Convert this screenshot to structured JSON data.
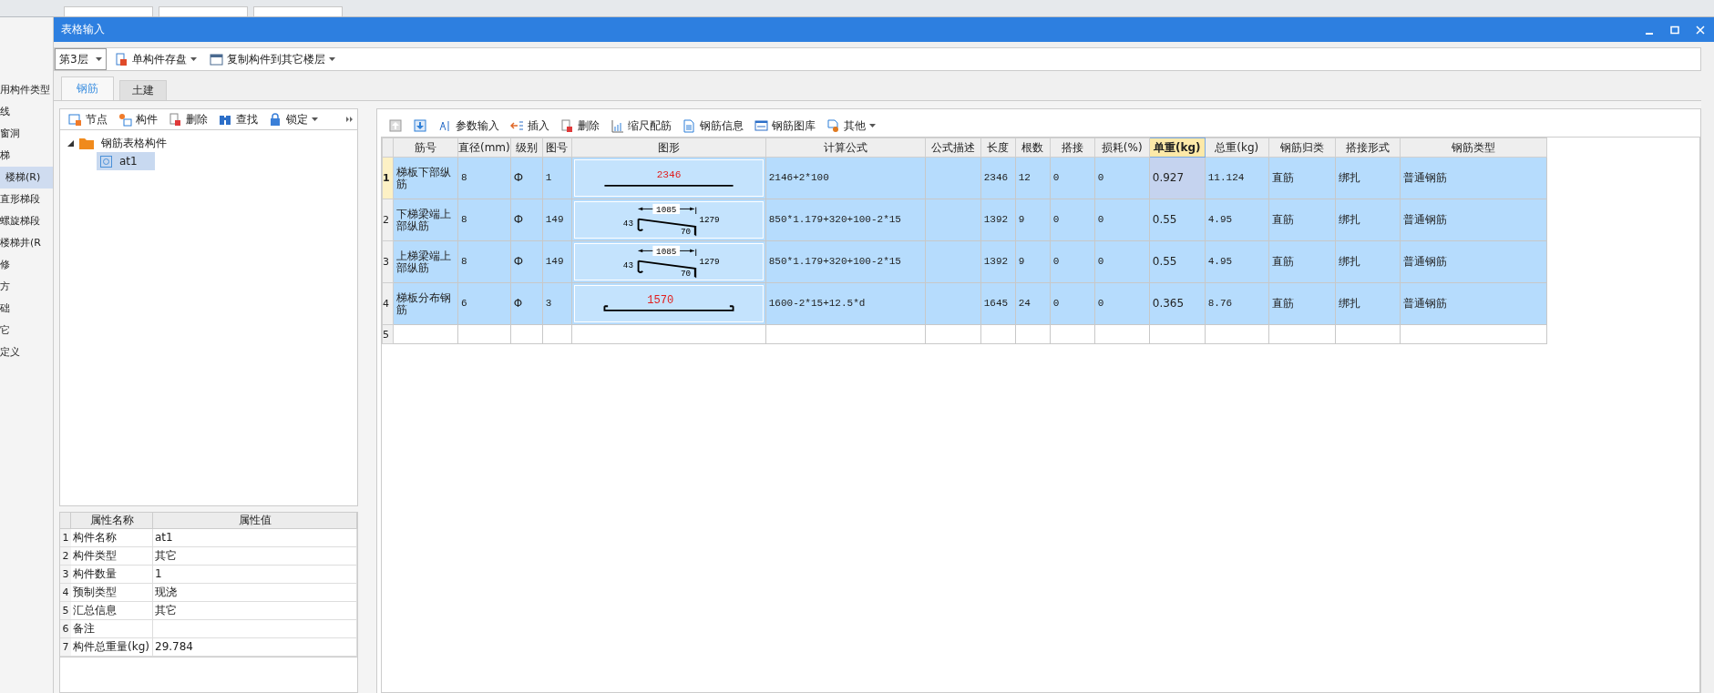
{
  "background_app": {
    "sidebar_items": [
      {
        "label": "用构件类型",
        "selected": false
      },
      {
        "label": "线",
        "selected": false
      },
      {
        "label": "窗洞",
        "selected": false
      },
      {
        "label": "梯",
        "selected": false
      },
      {
        "label": "楼梯(R)",
        "selected": true
      },
      {
        "label": "直形梯段",
        "selected": false
      },
      {
        "label": "螺旋梯段",
        "selected": false
      },
      {
        "label": "楼梯井(R",
        "selected": false
      },
      {
        "label": "修",
        "selected": false
      },
      {
        "label": "方",
        "selected": false
      },
      {
        "label": "础",
        "selected": false
      },
      {
        "label": "它",
        "selected": false
      },
      {
        "label": "定义",
        "selected": false
      }
    ]
  },
  "window": {
    "title": "表格输入"
  },
  "toolbar": {
    "floor_select": {
      "value": "第3层"
    },
    "buttons": [
      {
        "kind": "save",
        "label": "单构件存盘",
        "dropdown": true
      },
      {
        "kind": "copy",
        "label": "复制构件到其它楼层",
        "dropdown": true
      }
    ]
  },
  "tabs": [
    {
      "label": "钢筋",
      "selected": true
    },
    {
      "label": "土建",
      "selected": false
    }
  ],
  "component_panel": {
    "toolbar": [
      {
        "kind": "node",
        "label": "节点",
        "dropdown": false
      },
      {
        "kind": "component",
        "label": "构件",
        "dropdown": false
      },
      {
        "kind": "delete",
        "label": "删除",
        "dropdown": false
      },
      {
        "kind": "find",
        "label": "查找",
        "dropdown": false
      },
      {
        "kind": "lock",
        "label": "锁定",
        "dropdown": true
      }
    ],
    "tree": [
      {
        "label": "钢筋表格构件",
        "expanded": true,
        "selected": false,
        "children": [
          {
            "label": "at1",
            "selected": true
          }
        ]
      }
    ],
    "properties": {
      "columns": [
        "属性名称",
        "属性值"
      ],
      "rows": [
        {
          "no": "1",
          "name": "构件名称",
          "value": "at1"
        },
        {
          "no": "2",
          "name": "构件类型",
          "value": "其它"
        },
        {
          "no": "3",
          "name": "构件数量",
          "value": "1"
        },
        {
          "no": "4",
          "name": "预制类型",
          "value": "现浇"
        },
        {
          "no": "5",
          "name": "汇总信息",
          "value": "其它"
        },
        {
          "no": "6",
          "name": "备注"
        },
        {
          "no": "7",
          "name": "构件总重量(kg)",
          "value": "29.784"
        }
      ]
    }
  },
  "rebar_panel": {
    "toolbar": [
      {
        "kind": "up",
        "dropdown": false
      },
      {
        "kind": "down",
        "dropdown": false
      },
      {
        "kind": "param",
        "label": "参数输入",
        "dropdown": false
      },
      {
        "kind": "insert",
        "label": "插入",
        "dropdown": false
      },
      {
        "kind": "delete",
        "label": "删除",
        "dropdown": false
      },
      {
        "kind": "scale",
        "label": "缩尺配筋",
        "dropdown": false
      },
      {
        "kind": "info",
        "label": "钢筋信息",
        "dropdown": false
      },
      {
        "kind": "library",
        "label": "钢筋图库",
        "dropdown": false
      },
      {
        "kind": "other",
        "label": "其他",
        "dropdown": true
      }
    ],
    "table": {
      "columns": [
        {
          "label": "筋号",
          "active": false
        },
        {
          "label": "直径(mm)",
          "active": false
        },
        {
          "label": "级别",
          "active": false
        },
        {
          "label": "图号",
          "active": false
        },
        {
          "label": "图形",
          "active": false
        },
        {
          "label": "计算公式",
          "active": false
        },
        {
          "label": "公式描述",
          "active": false
        },
        {
          "label": "长度",
          "active": false
        },
        {
          "label": "根数",
          "active": false
        },
        {
          "label": "搭接",
          "active": false
        },
        {
          "label": "损耗(%)",
          "active": false
        },
        {
          "label": "单重(kg)",
          "active": true
        },
        {
          "label": "总重(kg)",
          "active": false
        },
        {
          "label": "钢筋归类",
          "active": false
        },
        {
          "label": "搭接形式",
          "active": false
        },
        {
          "label": "钢筋类型",
          "active": false
        }
      ],
      "rows": [
        {
          "no": "1",
          "selected": true,
          "current": true,
          "cells": [
            "梯板下部纵筋",
            "8",
            "Ф",
            "1",
            {
              "kind": "straight",
              "labels": [
                "2346"
              ]
            },
            "2146+2*100",
            null,
            "2346",
            "12",
            "0",
            "0",
            "0.927",
            "11.124",
            "直筋",
            "绑扎",
            "普通钢筋"
          ]
        },
        {
          "no": "2",
          "selected": true,
          "current": false,
          "cells": [
            "下梯梁端上部纵筋",
            "8",
            "Ф",
            "149",
            {
              "kind": "bent",
              "labels": [
                "1085",
                "43",
                "1279",
                "70"
              ]
            },
            "850*1.179+320+100-2*15",
            null,
            "1392",
            "9",
            "0",
            "0",
            "0.55",
            "4.95",
            "直筋",
            "绑扎",
            "普通钢筋"
          ]
        },
        {
          "no": "3",
          "selected": true,
          "current": false,
          "cells": [
            "上梯梁端上部纵筋",
            "8",
            "Ф",
            "149",
            {
              "kind": "bent",
              "labels": [
                "1085",
                "43",
                "1279",
                "70"
              ]
            },
            "850*1.179+320+100-2*15",
            null,
            "1392",
            "9",
            "0",
            "0",
            "0.55",
            "4.95",
            "直筋",
            "绑扎",
            "普通钢筋"
          ]
        },
        {
          "no": "4",
          "selected": true,
          "current": false,
          "cells": [
            "梯板分布钢筋",
            "6",
            "Φ",
            "3",
            {
              "kind": "hooked",
              "labels": [
                "1570"
              ]
            },
            "1600-2*15+12.5*d",
            null,
            "1645",
            "24",
            "0",
            "0",
            "0.365",
            "8.76",
            "直筋",
            "绑扎",
            "普通钢筋"
          ]
        },
        {
          "no": "5",
          "selected": false,
          "current": false
        }
      ]
    }
  }
}
